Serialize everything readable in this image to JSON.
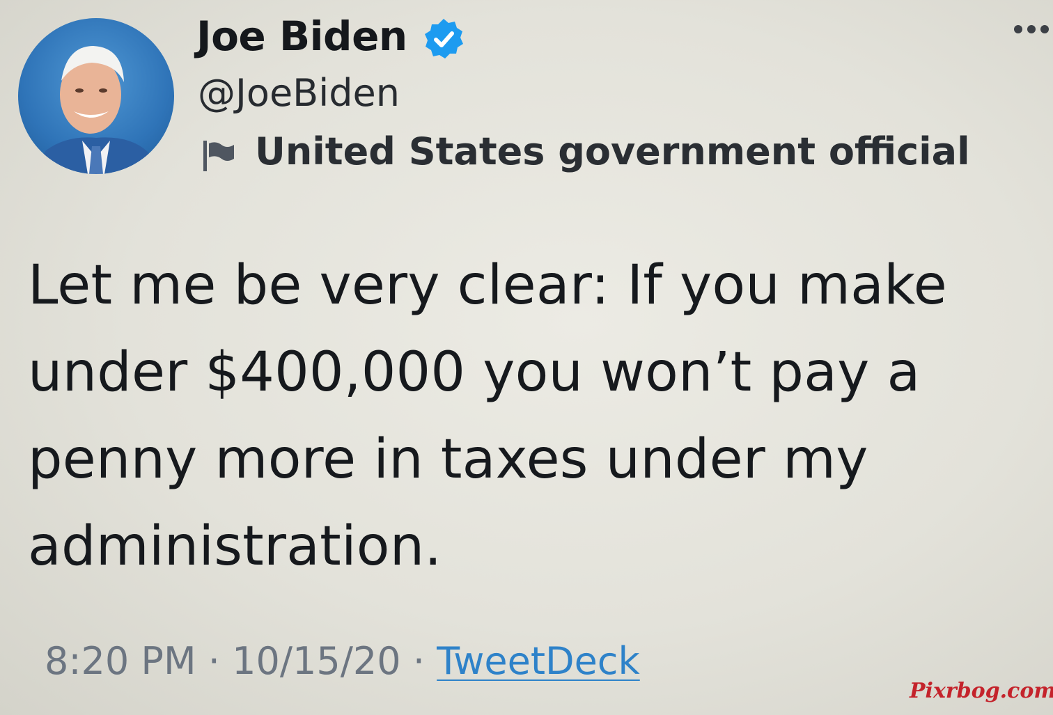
{
  "tweet": {
    "author": {
      "display_name": "Joe Biden",
      "handle": "@JoeBiden",
      "verified": true,
      "label": "United States government official"
    },
    "body_lines": [
      "Let me be very clear: If you make",
      "under $400,000 you won’t pay a",
      "penny more in taxes under my",
      "administration."
    ],
    "meta": {
      "time": "8:20 PM",
      "separator": "·",
      "date": "10/15/20",
      "source": "TweetDeck"
    }
  },
  "watermark": "Pixrbog.com",
  "colors": {
    "verified_badge": "#1d9bf0",
    "link": "#2e82c9",
    "meta_text": "#6c7581",
    "watermark": "#c4232b"
  },
  "icons": {
    "verified": "verified-badge-icon",
    "label": "flag-icon",
    "more": "more-icon"
  }
}
